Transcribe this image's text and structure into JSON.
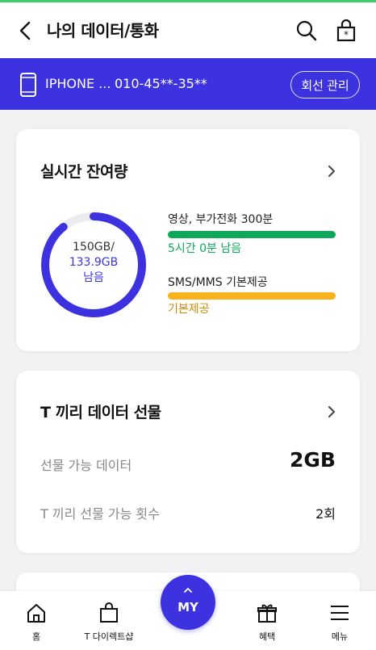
{
  "header": {
    "title": "나의 데이터/통화"
  },
  "line": {
    "name": "IPHONE ...",
    "number": "010-45**-35**",
    "manage_label": "회선 관리"
  },
  "realtime": {
    "title": "실시간 잔여량",
    "donut": {
      "total": "150GB/",
      "remaining": "133.9GB",
      "suffix": "남음",
      "remaining_fraction": 0.893
    },
    "items": [
      {
        "label": "영상, 부가전화 300분",
        "status": "5시간 0분 남음",
        "color": "#0fa85a",
        "fill": 1.0
      },
      {
        "label": "SMS/MMS 기본제공",
        "status": "기본제공",
        "color": "#f7b21d",
        "fill": 1.0
      }
    ]
  },
  "gift": {
    "title": "T 끼리 데이터 선물",
    "rows": [
      {
        "label": "선물 가능 데이터",
        "value": "2GB"
      },
      {
        "label": "T 끼리 선물 가능 횟수",
        "value": "2회"
      }
    ]
  },
  "nav": {
    "home": "홈",
    "shop": "T 다이렉트샵",
    "my": "MY",
    "benefits": "혜택",
    "menu": "메뉴"
  },
  "colors": {
    "brand": "#3d32e0",
    "green": "#0fa85a",
    "yellow": "#f7b21d",
    "top_accent": "#3ecf6b"
  }
}
